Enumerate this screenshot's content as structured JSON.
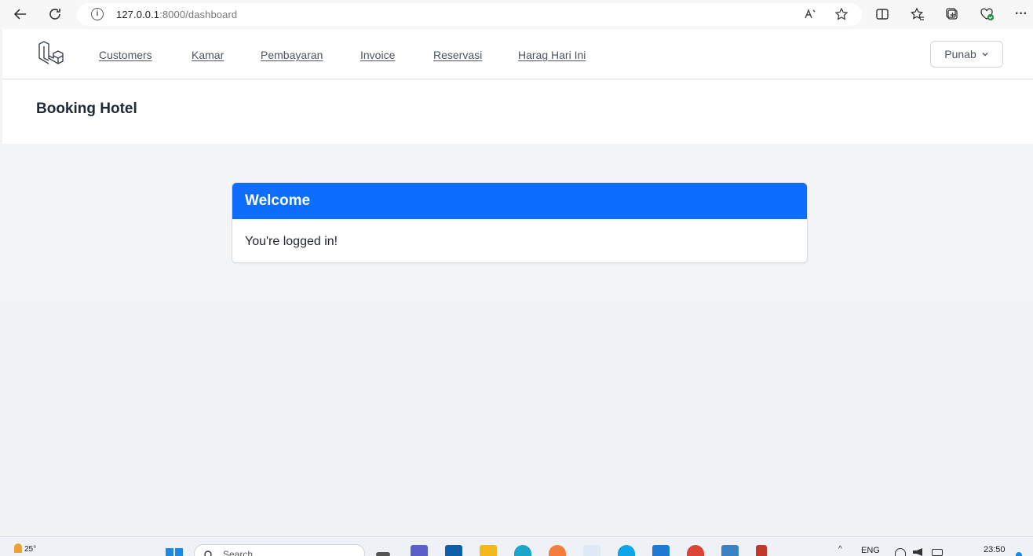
{
  "browser": {
    "url_host": "127.0.0.1",
    "url_path": ":8000/dashboard"
  },
  "navbar": {
    "links": [
      "Customers",
      "Kamar",
      "Pembayaran",
      "Invoice",
      "Reservasi",
      "Harag Hari Ini"
    ],
    "user_name": "Punab"
  },
  "header": {
    "title": "Booking Hotel"
  },
  "card": {
    "title": "Welcome",
    "message": "You're logged in!"
  },
  "taskbar": {
    "weather": "25°",
    "search_placeholder": "Search",
    "language": "ENG",
    "time": "23:50"
  },
  "colors": {
    "accent": "#0d6efd",
    "page_bg": "#f3f4f6"
  }
}
